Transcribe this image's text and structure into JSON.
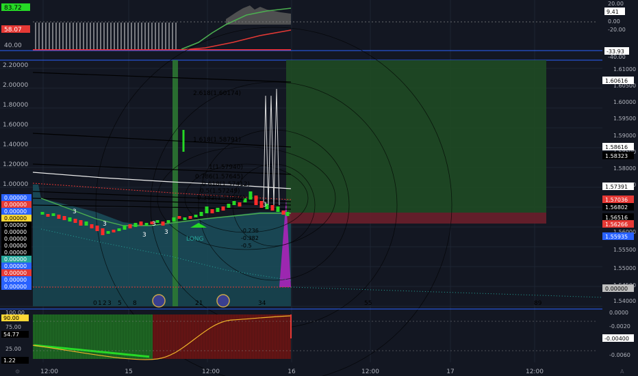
{
  "colors": {
    "background": "#131722",
    "grid": "#1e2433",
    "separator": "#2962ff",
    "up": "#26d926",
    "down": "#ff2b2b",
    "teal_fill": "#1b4f5c",
    "target_zone": "#1f4a23",
    "stop_zone": "#6b1f2b",
    "purple": "#9c27b0",
    "text": "#b2b5be"
  },
  "top_pane": {
    "left_badges": [
      "83.72",
      "58.07"
    ],
    "left_label": "40.00",
    "right_axis": [
      "20.00",
      "9.41",
      "0.00",
      "-20.00",
      "-33.93",
      "-40.00"
    ]
  },
  "main_pane": {
    "left_axis": [
      "2.20000",
      "2.00000",
      "1.80000",
      "1.60000",
      "1.40000",
      "1.20000",
      "1.00000"
    ],
    "left_badges": [
      "0.00000",
      "0.00000",
      "0.00000",
      "0.00000",
      "0.00000",
      "0.00000",
      "0.00000",
      "0.00000",
      "0.00000",
      "0.00000",
      "0.00000",
      "0.00000",
      "0.00000",
      "0.00000"
    ],
    "right_axis": [
      "1.61000",
      "1.60500",
      "1.60000",
      "1.59500",
      "1.59000",
      "1.58500",
      "1.58000",
      "1.57500",
      "1.56000",
      "1.55500",
      "1.55000",
      "1.54500",
      "1.54000"
    ],
    "right_badges": [
      "1.60616",
      "1.58616",
      "1.58323",
      "1.57391",
      "1.57036",
      "1.56802",
      "1.56516",
      "1.56266",
      "1.55935",
      "0.00000"
    ],
    "fib_labels": [
      "2.618(1.60174)",
      "1.618(1.58791)",
      "1(1.57940)",
      "0.786(1.57645)",
      "0.618(1.57412)",
      "0.5(1.57249)",
      "0.382(1.57086)"
    ],
    "lower_fib_labels": [
      "-0.236",
      "-0.382",
      "-0.5"
    ],
    "counts": [
      "3",
      "3",
      "3",
      "3",
      "3",
      "3"
    ],
    "long_label": "LONG",
    "bottom_counts": [
      "0",
      "1",
      "2",
      "3",
      "5",
      "8",
      "21",
      "34",
      "55",
      "89"
    ]
  },
  "bottom_pane": {
    "left_labels": [
      "100.00",
      "90.00",
      "75.00",
      "54.77",
      "25.00",
      "1.22"
    ],
    "right_axis": [
      "0.0000",
      "-0.0020",
      "-0.00400",
      "-0.0060"
    ]
  },
  "time_axis": [
    "12:00",
    "15",
    "12:00",
    "16",
    "12:00",
    "17",
    "12:00"
  ]
}
